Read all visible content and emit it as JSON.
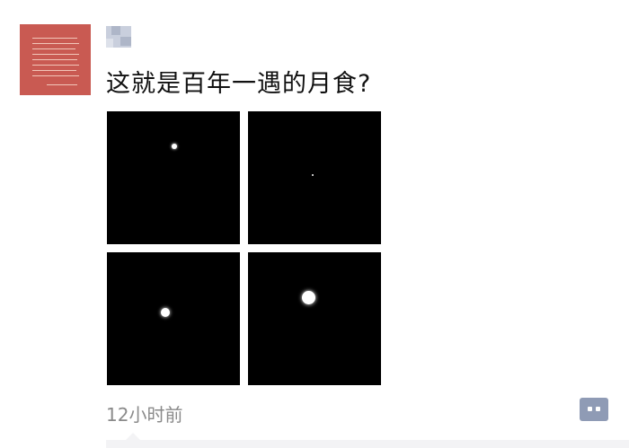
{
  "post": {
    "text": "这就是百年一遇的月食?",
    "timestamp": "12小时前"
  },
  "photos": [
    {
      "label": "photo-1",
      "moon": "small-bright-dot"
    },
    {
      "label": "photo-2",
      "moon": "tiny-dot"
    },
    {
      "label": "photo-3",
      "moon": "medium-dot"
    },
    {
      "label": "photo-4",
      "moon": "large-dot"
    }
  ],
  "icons": {
    "comment": "comment-dots-icon"
  },
  "colors": {
    "avatar": "#c95a52",
    "photo_background": "#000000",
    "timestamp": "#8a8a8a",
    "comment_button": "#8f9bb5"
  }
}
